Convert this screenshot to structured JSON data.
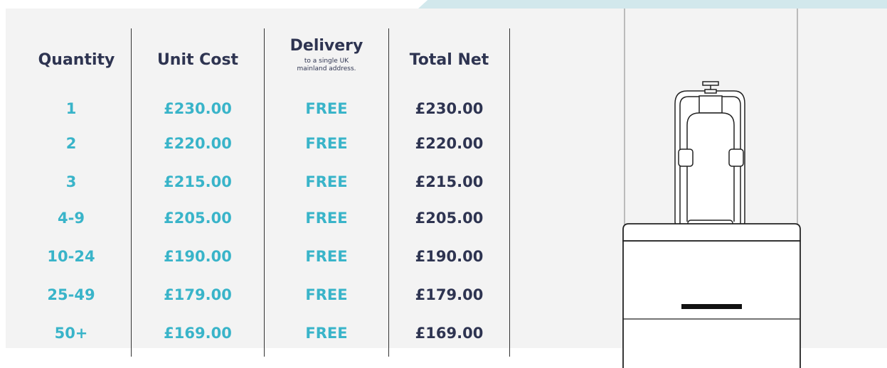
{
  "headers": {
    "quantity": "Quantity",
    "unit_cost": "Unit Cost",
    "delivery": "Delivery",
    "delivery_note_line1": "to a single UK",
    "delivery_note_line2": "mainland address.",
    "total_net": "Total Net"
  },
  "rows": [
    {
      "quantity": "1",
      "unit_cost": "£230.00",
      "delivery": "FREE",
      "total_net": "£230.00"
    },
    {
      "quantity": "2",
      "unit_cost": "£220.00",
      "delivery": "FREE",
      "total_net": "£220.00"
    },
    {
      "quantity": "3",
      "unit_cost": "£215.00",
      "delivery": "FREE",
      "total_net": "£215.00"
    },
    {
      "quantity": "4-9",
      "unit_cost": "£205.00",
      "delivery": "FREE",
      "total_net": "£205.00"
    },
    {
      "quantity": "10-24",
      "unit_cost": "£190.00",
      "delivery": "FREE",
      "total_net": "£190.00"
    },
    {
      "quantity": "25-49",
      "unit_cost": "£179.00",
      "delivery": "FREE",
      "total_net": "£179.00"
    },
    {
      "quantity": "50+",
      "unit_cost": "£169.00",
      "delivery": "FREE",
      "total_net": "£169.00"
    }
  ],
  "colors": {
    "accent_teal": "#39b4c9",
    "text_navy": "#2e3451",
    "panel_bg": "#f3f3f3",
    "top_accent": "#d2e8ec"
  },
  "illustration": {
    "icon": "dispenser-stand-icon"
  }
}
